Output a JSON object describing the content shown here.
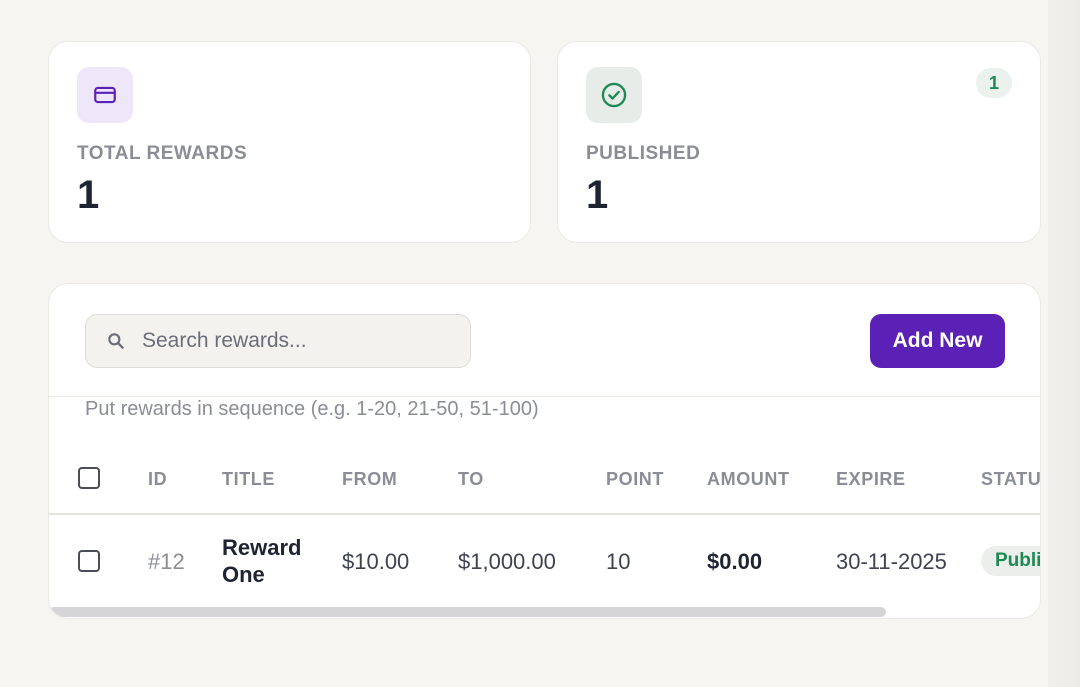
{
  "stats": [
    {
      "label": "TOTAL REWARDS",
      "value": "1",
      "icon": "card-icon",
      "color": "#5b21b6"
    },
    {
      "label": "PUBLISHED",
      "value": "1",
      "icon": "check-circle-icon",
      "badge": "1",
      "color": "#1d8a56"
    }
  ],
  "toolbar": {
    "search_placeholder": "Search rewards...",
    "add_label": "Add New",
    "accent": "#5b21b6"
  },
  "hint": "Put rewards in sequence (e.g. 1-20, 21-50, 51-100)",
  "table": {
    "headers": [
      "ID",
      "TITLE",
      "FROM",
      "TO",
      "POINT",
      "AMOUNT",
      "EXPIRE",
      "STATUS"
    ],
    "rows": [
      {
        "id": "#12",
        "title": "Reward One",
        "from": "$10.00",
        "to": "$1,000.00",
        "point": "10",
        "amount": "$0.00",
        "expire": "30-11-2025",
        "status": "Published"
      }
    ]
  }
}
